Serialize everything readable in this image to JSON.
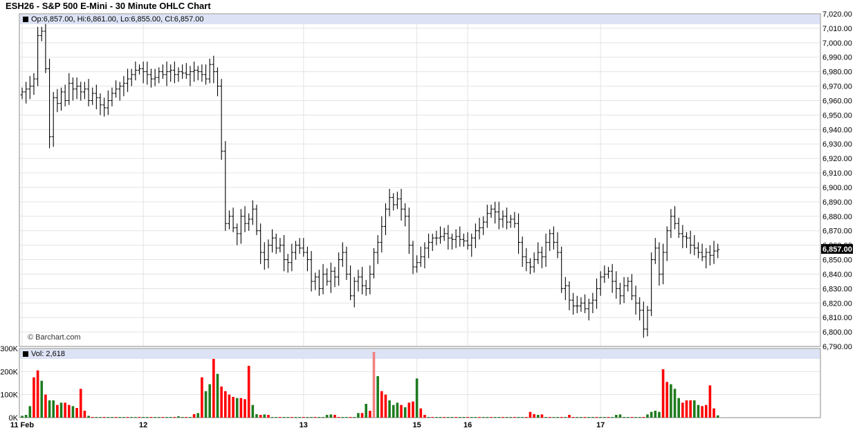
{
  "title": "ESH26 - S&P 500 E-Mini - 30 Minute OHLC Chart",
  "price_panel": {
    "ohlc_readout": "Op:6,857.00, Hi:6,861.00, Lo:6,855.00, Cl:6,857.00",
    "last_price_label": "6,857.00",
    "watermark": "© Barchart.com"
  },
  "volume_panel": {
    "readout": "Vol: 2,618"
  },
  "colors": {
    "up_volume": "#1e7b1e",
    "down_volume": "#ff0000",
    "last_volume": "#f08080",
    "bar": "#000000",
    "grid": "#e3e3e3",
    "readout_bg": "#dde3f5"
  },
  "chart_data": [
    {
      "type": "ohlc",
      "title": "ESH26 - S&P 500 E-Mini - 30 Minute OHLC Chart",
      "ylim": [
        6790,
        7020
      ],
      "y_ticks": [
        "7,020.00",
        "7,010.00",
        "7,000.00",
        "6,990.00",
        "6,980.00",
        "6,970.00",
        "6,960.00",
        "6,950.00",
        "6,940.00",
        "6,930.00",
        "6,920.00",
        "6,910.00",
        "6,900.00",
        "6,890.00",
        "6,880.00",
        "6,870.00",
        "6,860.00",
        "6,850.00",
        "6,840.00",
        "6,830.00",
        "6,820.00",
        "6,810.00",
        "6,800.00",
        "6,790.00"
      ],
      "x_ticks": [
        {
          "label": "11 Feb",
          "index": 0
        },
        {
          "label": "12",
          "index": 31
        },
        {
          "label": "13",
          "index": 72
        },
        {
          "label": "15",
          "index": 101
        },
        {
          "label": "16",
          "index": 114
        },
        {
          "label": "17",
          "index": 148
        }
      ],
      "close_path": [
        6966,
        6968,
        6970,
        6975,
        7005,
        7008,
        6982,
        6935,
        6962,
        6958,
        6966,
        6960,
        6972,
        6968,
        6970,
        6966,
        6968,
        6960,
        6965,
        6962,
        6957,
        6955,
        6960,
        6965,
        6968,
        6970,
        6972,
        6975,
        6978,
        6981,
        6982,
        6980,
        6978,
        6975,
        6976,
        6980,
        6978,
        6980,
        6981,
        6978,
        6980,
        6979,
        6978,
        6980,
        6981,
        6980,
        6978,
        6975,
        6985,
        6980,
        6970,
        6925,
        6875,
        6880,
        6872,
        6868,
        6880,
        6875,
        6878,
        6885,
        6870,
        6855,
        6850,
        6860,
        6865,
        6858,
        6860,
        6850,
        6848,
        6855,
        6860,
        6858,
        6855,
        6850,
        6835,
        6838,
        6830,
        6840,
        6835,
        6842,
        6838,
        6850,
        6855,
        6840,
        6825,
        6835,
        6838,
        6832,
        6830,
        6840,
        6855,
        6862,
        6873,
        6885,
        6893,
        6888,
        6892,
        6885,
        6880,
        6860,
        6845,
        6848,
        6852,
        6858,
        6862,
        6865,
        6865,
        6866,
        6868,
        6865,
        6864,
        6866,
        6864,
        6863,
        6860,
        6865,
        6870,
        6872,
        6876,
        6882,
        6885,
        6883,
        6878,
        6880,
        6876,
        6878,
        6875,
        6862,
        6852,
        6848,
        6845,
        6850,
        6855,
        6852,
        6862,
        6868,
        6862,
        6855,
        6830,
        6832,
        6822,
        6818,
        6818,
        6820,
        6816,
        6820,
        6822,
        6830,
        6838,
        6840,
        6842,
        6835,
        6830,
        6825,
        6832,
        6835,
        6825,
        6820,
        6815,
        6802,
        6815,
        6850,
        6858,
        6840,
        6855,
        6870,
        6880,
        6875,
        6868,
        6866,
        6865,
        6860,
        6858,
        6855,
        6852,
        6855,
        6853,
        6856,
        6857
      ],
      "volume_ylim": [
        0,
        300000
      ],
      "volume_ticks": [
        "300K",
        "200K",
        "100K",
        "0K"
      ],
      "volume_bars": [
        {
          "index": 0,
          "v": 8000,
          "dir": "up"
        },
        {
          "index": 1,
          "v": 12000,
          "dir": "up"
        },
        {
          "index": 2,
          "v": 50000,
          "dir": "up"
        },
        {
          "index": 3,
          "v": 175000,
          "dir": "down"
        },
        {
          "index": 4,
          "v": 205000,
          "dir": "down"
        },
        {
          "index": 5,
          "v": 160000,
          "dir": "up"
        },
        {
          "index": 6,
          "v": 100000,
          "dir": "down"
        },
        {
          "index": 7,
          "v": 75000,
          "dir": "up"
        },
        {
          "index": 8,
          "v": 75000,
          "dir": "up"
        },
        {
          "index": 9,
          "v": 55000,
          "dir": "down"
        },
        {
          "index": 10,
          "v": 65000,
          "dir": "up"
        },
        {
          "index": 11,
          "v": 65000,
          "dir": "down"
        },
        {
          "index": 12,
          "v": 55000,
          "dir": "down"
        },
        {
          "index": 13,
          "v": 50000,
          "dir": "up"
        },
        {
          "index": 14,
          "v": 42000,
          "dir": "down"
        },
        {
          "index": 15,
          "v": 125000,
          "dir": "down"
        },
        {
          "index": 16,
          "v": 30000,
          "dir": "down"
        },
        {
          "index": 17,
          "v": 8000,
          "dir": "up"
        },
        {
          "index": 40,
          "v": 6000,
          "dir": "up"
        },
        {
          "index": 44,
          "v": 15000,
          "dir": "down"
        },
        {
          "index": 45,
          "v": 20000,
          "dir": "up"
        },
        {
          "index": 46,
          "v": 175000,
          "dir": "down"
        },
        {
          "index": 47,
          "v": 115000,
          "dir": "up"
        },
        {
          "index": 48,
          "v": 145000,
          "dir": "up"
        },
        {
          "index": 49,
          "v": 255000,
          "dir": "down"
        },
        {
          "index": 50,
          "v": 190000,
          "dir": "up"
        },
        {
          "index": 51,
          "v": 135000,
          "dir": "down"
        },
        {
          "index": 52,
          "v": 115000,
          "dir": "down"
        },
        {
          "index": 53,
          "v": 100000,
          "dir": "down"
        },
        {
          "index": 54,
          "v": 90000,
          "dir": "down"
        },
        {
          "index": 55,
          "v": 85000,
          "dir": "up"
        },
        {
          "index": 56,
          "v": 85000,
          "dir": "down"
        },
        {
          "index": 57,
          "v": 80000,
          "dir": "down"
        },
        {
          "index": 58,
          "v": 225000,
          "dir": "down"
        },
        {
          "index": 59,
          "v": 55000,
          "dir": "up"
        },
        {
          "index": 60,
          "v": 15000,
          "dir": "up"
        },
        {
          "index": 61,
          "v": 12000,
          "dir": "down"
        },
        {
          "index": 62,
          "v": 14000,
          "dir": "up"
        },
        {
          "index": 63,
          "v": 12000,
          "dir": "down"
        },
        {
          "index": 78,
          "v": 12000,
          "dir": "up"
        },
        {
          "index": 79,
          "v": 14000,
          "dir": "up"
        },
        {
          "index": 80,
          "v": 12000,
          "dir": "down"
        },
        {
          "index": 86,
          "v": 20000,
          "dir": "up"
        },
        {
          "index": 87,
          "v": 20000,
          "dir": "down"
        },
        {
          "index": 88,
          "v": 60000,
          "dir": "up"
        },
        {
          "index": 89,
          "v": 30000,
          "dir": "down"
        },
        {
          "index": 90,
          "v": 285000,
          "dir": "last"
        },
        {
          "index": 91,
          "v": 180000,
          "dir": "up"
        },
        {
          "index": 92,
          "v": 115000,
          "dir": "down"
        },
        {
          "index": 93,
          "v": 100000,
          "dir": "down"
        },
        {
          "index": 94,
          "v": 75000,
          "dir": "up"
        },
        {
          "index": 95,
          "v": 55000,
          "dir": "up"
        },
        {
          "index": 96,
          "v": 65000,
          "dir": "up"
        },
        {
          "index": 97,
          "v": 55000,
          "dir": "down"
        },
        {
          "index": 98,
          "v": 45000,
          "dir": "up"
        },
        {
          "index": 99,
          "v": 65000,
          "dir": "down"
        },
        {
          "index": 100,
          "v": 70000,
          "dir": "down"
        },
        {
          "index": 101,
          "v": 170000,
          "dir": "up"
        },
        {
          "index": 102,
          "v": 40000,
          "dir": "down"
        },
        {
          "index": 103,
          "v": 12000,
          "dir": "down"
        },
        {
          "index": 130,
          "v": 25000,
          "dir": "down"
        },
        {
          "index": 131,
          "v": 15000,
          "dir": "down"
        },
        {
          "index": 132,
          "v": 12000,
          "dir": "up"
        },
        {
          "index": 133,
          "v": 14000,
          "dir": "down"
        },
        {
          "index": 140,
          "v": 12000,
          "dir": "down"
        },
        {
          "index": 152,
          "v": 12000,
          "dir": "up"
        },
        {
          "index": 153,
          "v": 14000,
          "dir": "up"
        },
        {
          "index": 160,
          "v": 14000,
          "dir": "up"
        },
        {
          "index": 161,
          "v": 25000,
          "dir": "up"
        },
        {
          "index": 162,
          "v": 30000,
          "dir": "up"
        },
        {
          "index": 163,
          "v": 25000,
          "dir": "up"
        },
        {
          "index": 164,
          "v": 210000,
          "dir": "down"
        },
        {
          "index": 165,
          "v": 155000,
          "dir": "down"
        },
        {
          "index": 166,
          "v": 145000,
          "dir": "up"
        },
        {
          "index": 167,
          "v": 125000,
          "dir": "up"
        },
        {
          "index": 168,
          "v": 85000,
          "dir": "up"
        },
        {
          "index": 169,
          "v": 65000,
          "dir": "down"
        },
        {
          "index": 170,
          "v": 75000,
          "dir": "down"
        },
        {
          "index": 171,
          "v": 75000,
          "dir": "down"
        },
        {
          "index": 172,
          "v": 75000,
          "dir": "up"
        },
        {
          "index": 173,
          "v": 55000,
          "dir": "up"
        },
        {
          "index": 174,
          "v": 50000,
          "dir": "down"
        },
        {
          "index": 175,
          "v": 55000,
          "dir": "down"
        },
        {
          "index": 176,
          "v": 140000,
          "dir": "down"
        },
        {
          "index": 177,
          "v": 40000,
          "dir": "down"
        },
        {
          "index": 178,
          "v": 10000,
          "dir": "up"
        }
      ],
      "grid": true
    }
  ]
}
